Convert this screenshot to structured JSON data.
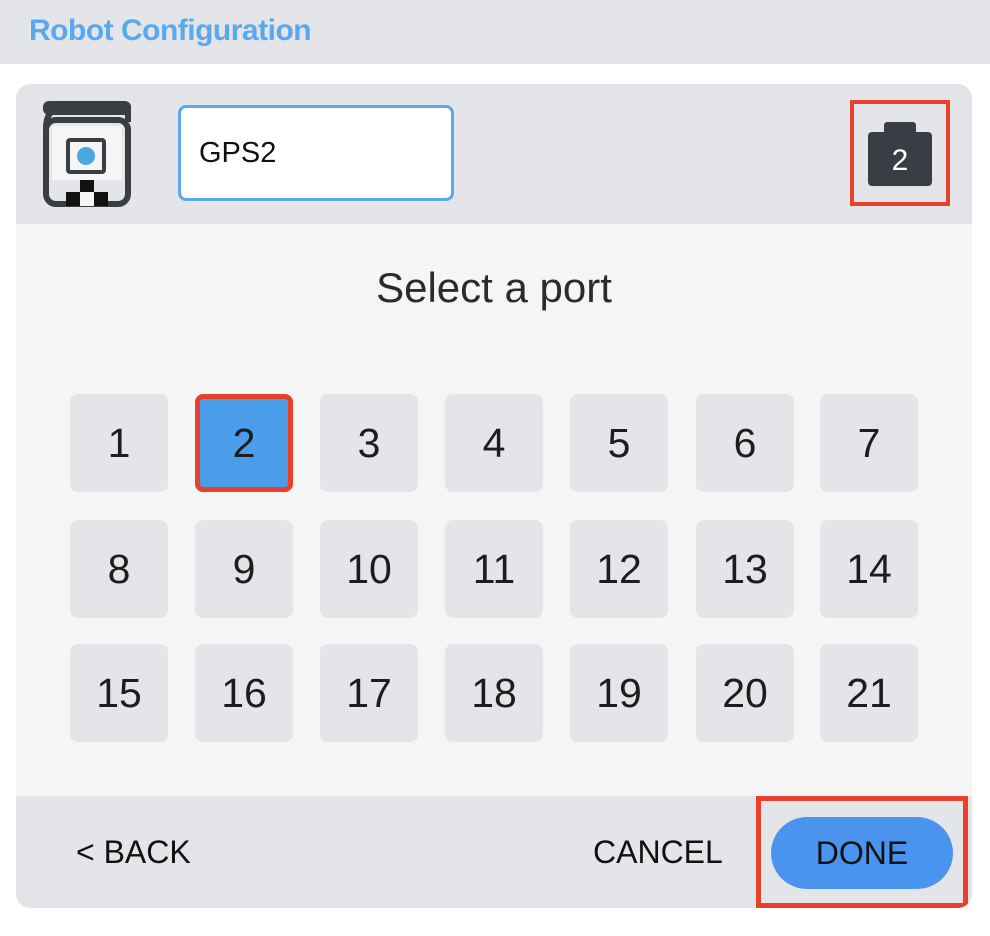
{
  "header": {
    "title": "Robot Configuration"
  },
  "device": {
    "icon": "gps-sensor-icon",
    "name_value": "GPS2",
    "port_indicator_icon": "port-plug-icon",
    "port_indicator_label": "2"
  },
  "prompt": "Select a port",
  "ports": [
    "1",
    "2",
    "3",
    "4",
    "5",
    "6",
    "7",
    "8",
    "9",
    "10",
    "11",
    "12",
    "13",
    "14",
    "15",
    "16",
    "17",
    "18",
    "19",
    "20",
    "21"
  ],
  "selected_port": "2",
  "footer": {
    "back_label": "< BACK",
    "cancel_label": "CANCEL",
    "done_label": "DONE"
  },
  "colors": {
    "accent": "#4a94f0",
    "highlight": "#e9402b",
    "title": "#5aa8ef"
  }
}
